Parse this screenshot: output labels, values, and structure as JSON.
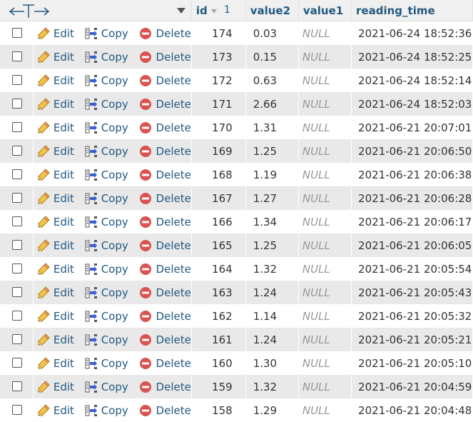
{
  "header": {
    "id": "id",
    "sort_order": "1",
    "value2": "value2",
    "value1": "value1",
    "reading_time": "reading_time"
  },
  "actions": {
    "edit": "Edit",
    "copy": "Copy",
    "delete": "Delete"
  },
  "rows": [
    {
      "id": "174",
      "value2": "0.03",
      "value1": "NULL",
      "reading_time": "2021-06-24 18:52:36"
    },
    {
      "id": "173",
      "value2": "0.15",
      "value1": "NULL",
      "reading_time": "2021-06-24 18:52:25"
    },
    {
      "id": "172",
      "value2": "0.63",
      "value1": "NULL",
      "reading_time": "2021-06-24 18:52:14"
    },
    {
      "id": "171",
      "value2": "2.66",
      "value1": "NULL",
      "reading_time": "2021-06-24 18:52:03"
    },
    {
      "id": "170",
      "value2": "1.31",
      "value1": "NULL",
      "reading_time": "2021-06-21 20:07:01"
    },
    {
      "id": "169",
      "value2": "1.25",
      "value1": "NULL",
      "reading_time": "2021-06-21 20:06:50"
    },
    {
      "id": "168",
      "value2": "1.19",
      "value1": "NULL",
      "reading_time": "2021-06-21 20:06:38"
    },
    {
      "id": "167",
      "value2": "1.27",
      "value1": "NULL",
      "reading_time": "2021-06-21 20:06:28"
    },
    {
      "id": "166",
      "value2": "1.34",
      "value1": "NULL",
      "reading_time": "2021-06-21 20:06:17"
    },
    {
      "id": "165",
      "value2": "1.25",
      "value1": "NULL",
      "reading_time": "2021-06-21 20:06:05"
    },
    {
      "id": "164",
      "value2": "1.32",
      "value1": "NULL",
      "reading_time": "2021-06-21 20:05:54"
    },
    {
      "id": "163",
      "value2": "1.24",
      "value1": "NULL",
      "reading_time": "2021-06-21 20:05:43"
    },
    {
      "id": "162",
      "value2": "1.14",
      "value1": "NULL",
      "reading_time": "2021-06-21 20:05:32"
    },
    {
      "id": "161",
      "value2": "1.24",
      "value1": "NULL",
      "reading_time": "2021-06-21 20:05:21"
    },
    {
      "id": "160",
      "value2": "1.30",
      "value1": "NULL",
      "reading_time": "2021-06-21 20:05:10"
    },
    {
      "id": "159",
      "value2": "1.32",
      "value1": "NULL",
      "reading_time": "2021-06-21 20:04:59"
    },
    {
      "id": "158",
      "value2": "1.29",
      "value1": "NULL",
      "reading_time": "2021-06-21 20:04:48"
    }
  ],
  "icons": {
    "edit": "pencil-icon",
    "copy": "copy-icon",
    "delete": "delete-icon",
    "column_arrows": "column-arrows-icon",
    "sort": "sort-descending-icon",
    "dropdown": "dropdown-arrow-icon"
  },
  "colors": {
    "link": "#235a81",
    "header_bg": "#f0f0f0",
    "row_even_bg": "#e9e9e9",
    "null_text": "#999999",
    "delete_red": "#d9534f"
  }
}
